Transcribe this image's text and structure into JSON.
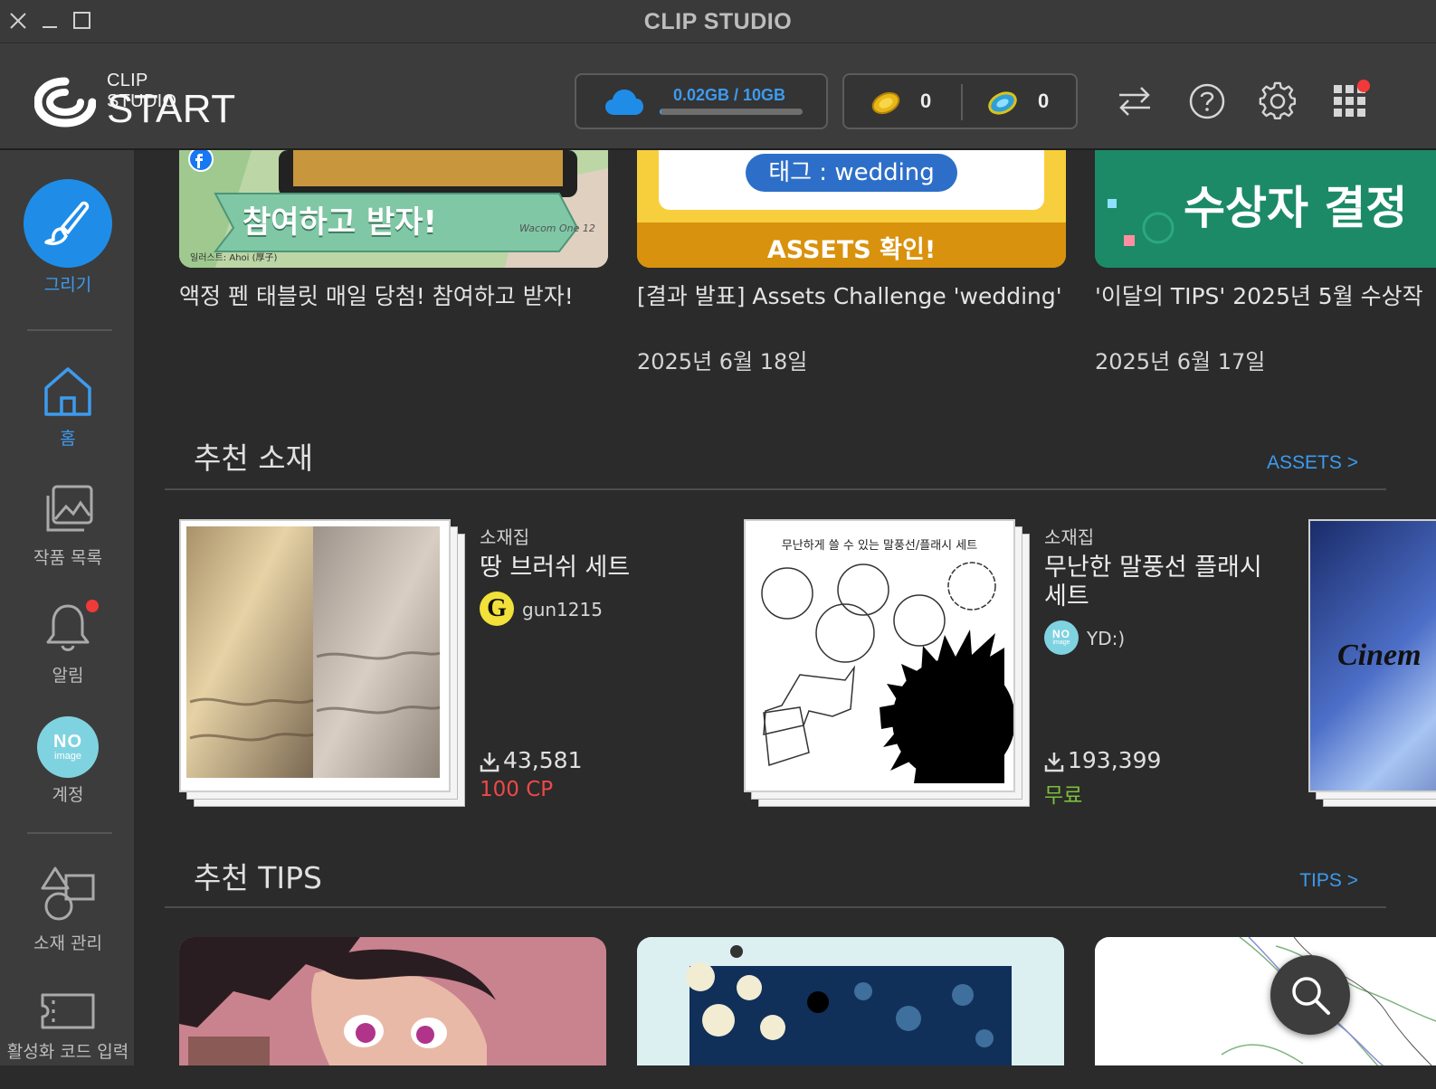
{
  "window": {
    "title": "CLIP STUDIO"
  },
  "header": {
    "logo_line1": "CLIP STUDIO",
    "logo_line2": "START",
    "cloud_usage": "0.02GB / 10GB",
    "cloud_fraction": 0.002,
    "gold_points": "0",
    "clippy_points": "0"
  },
  "sidebar": {
    "draw": "그리기",
    "home": "홈",
    "works": "작품 목록",
    "notifications": "알림",
    "account": "계정",
    "account_avatar_line1": "NO",
    "account_avatar_line2": "image",
    "assets_manage": "소재 관리",
    "activation": "활성화 코드 입력"
  },
  "news": [
    {
      "banner_text": "참여하고 받자!",
      "banner_credit": "일러스트: Ahoi (厚子)",
      "banner_device": "Wacom One 12",
      "title": "액정 펜 태블릿 매일 당첨! 참여하고 받자!",
      "date": ""
    },
    {
      "banner_tag": "태그 : wedding",
      "banner_cta": "ASSETS 확인!",
      "title": "[결과 발표] Assets Challenge 'wedding'",
      "date": "2025년 6월 18일"
    },
    {
      "banner_text": "수상자 결정",
      "title": "'이달의 TIPS' 2025년 5월 수상작",
      "date": "2025년 6월 17일"
    }
  ],
  "assets_section": {
    "title": "추천 소재",
    "link": "ASSETS >",
    "items": [
      {
        "category": "소재집",
        "title": "땅 브러쉬 세트",
        "author_initial": "G",
        "author": "gun1215",
        "downloads": "43,581",
        "price": "100 CP"
      },
      {
        "category": "소재집",
        "title": "무난한 말풍선 플래시 세트",
        "thumb_caption": "무난하게 쓸 수 있는 말풍선/플래시 세트",
        "author_avatar_line1": "NO",
        "author_avatar_line2": "image",
        "author": "YD:)",
        "downloads": "193,399",
        "price": "무료"
      },
      {
        "thumb_text": "Cinem"
      }
    ]
  },
  "tips_section": {
    "title": "추천 TIPS",
    "link": "TIPS >"
  },
  "colors": {
    "accent": "#3c9bef",
    "price_paid": "#f04848",
    "price_free": "#7cbf3c",
    "notification": "#f03a3a"
  }
}
